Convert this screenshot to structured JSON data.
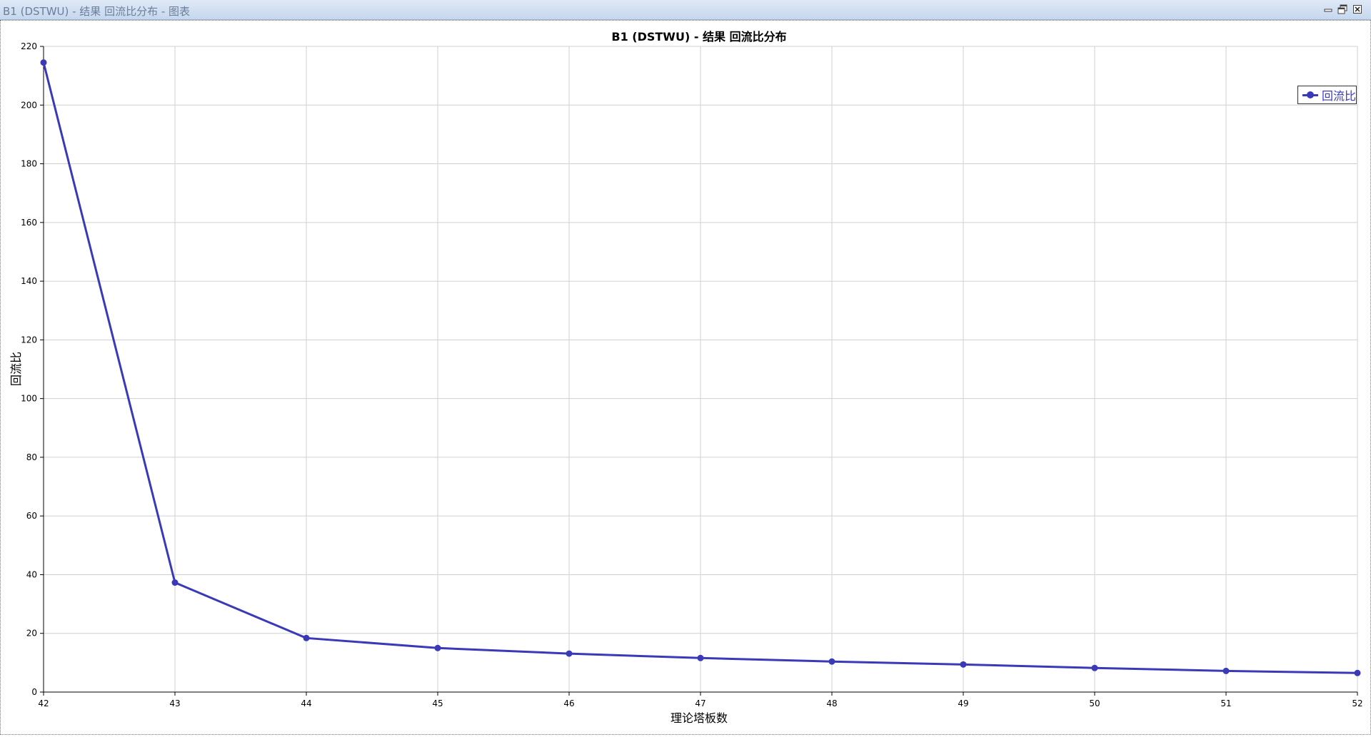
{
  "window": {
    "title": "B1 (DSTWU) - 结果 回流比分布 - 图表",
    "icons": {
      "minimize": "minimize-icon",
      "restore": "restore-icon",
      "close": "close-icon"
    }
  },
  "colors": {
    "series": "#3a3ab8",
    "grid": "#d0d0d0",
    "axis": "#000000"
  },
  "chart_data": {
    "type": "line",
    "title": "B1 (DSTWU) - 结果 回流比分布",
    "xlabel": "理论塔板数",
    "ylabel": "回流比",
    "xlim": [
      42,
      52
    ],
    "ylim": [
      0,
      220
    ],
    "x_ticks": [
      42,
      43,
      44,
      45,
      46,
      47,
      48,
      49,
      50,
      51,
      52
    ],
    "y_ticks": [
      0,
      20,
      40,
      60,
      80,
      100,
      120,
      140,
      160,
      180,
      200,
      220
    ],
    "grid": true,
    "legend_position": "top-right",
    "x": [
      42,
      43,
      44,
      45,
      46,
      47,
      48,
      49,
      50,
      51,
      52
    ],
    "series": [
      {
        "name": "回流比",
        "color": "#3a3ab8",
        "values": [
          214.5,
          37.3,
          18.4,
          15.0,
          13.1,
          11.6,
          10.4,
          9.4,
          8.2,
          7.2,
          6.5
        ]
      }
    ]
  }
}
